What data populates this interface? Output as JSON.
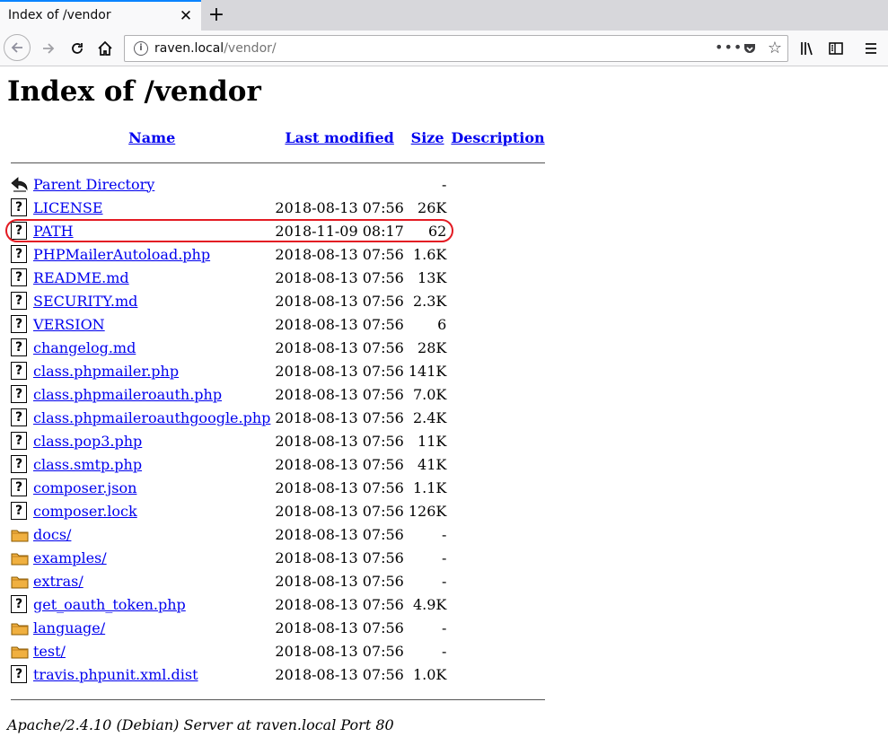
{
  "browser": {
    "tab_title": "Index of /vendor",
    "tab_close": "✕",
    "new_tab": "+",
    "url_host": "raven.local",
    "url_path": "/vendor/",
    "url_more": "•••"
  },
  "page": {
    "title": "Index of /vendor",
    "columns": {
      "name": "Name",
      "last_modified": "Last modified",
      "size": "Size",
      "description": "Description"
    },
    "parent": {
      "name": "Parent Directory",
      "size": "-"
    },
    "rows": [
      {
        "name": "LICENSE",
        "date": "2018-08-13 07:56",
        "size": "26K",
        "type": "file"
      },
      {
        "name": "PATH",
        "date": "2018-11-09 08:17",
        "size": "62",
        "type": "file"
      },
      {
        "name": "PHPMailerAutoload.php",
        "date": "2018-08-13 07:56",
        "size": "1.6K",
        "type": "file"
      },
      {
        "name": "README.md",
        "date": "2018-08-13 07:56",
        "size": "13K",
        "type": "file"
      },
      {
        "name": "SECURITY.md",
        "date": "2018-08-13 07:56",
        "size": "2.3K",
        "type": "file"
      },
      {
        "name": "VERSION",
        "date": "2018-08-13 07:56",
        "size": "6",
        "type": "file"
      },
      {
        "name": "changelog.md",
        "date": "2018-08-13 07:56",
        "size": "28K",
        "type": "file"
      },
      {
        "name": "class.phpmailer.php",
        "date": "2018-08-13 07:56",
        "size": "141K",
        "type": "file"
      },
      {
        "name": "class.phpmaileroauth.php",
        "date": "2018-08-13 07:56",
        "size": "7.0K",
        "type": "file"
      },
      {
        "name": "class.phpmaileroauthgoogle.php",
        "date": "2018-08-13 07:56",
        "size": "2.4K",
        "type": "file"
      },
      {
        "name": "class.pop3.php",
        "date": "2018-08-13 07:56",
        "size": "11K",
        "type": "file"
      },
      {
        "name": "class.smtp.php",
        "date": "2018-08-13 07:56",
        "size": "41K",
        "type": "file"
      },
      {
        "name": "composer.json",
        "date": "2018-08-13 07:56",
        "size": "1.1K",
        "type": "file"
      },
      {
        "name": "composer.lock",
        "date": "2018-08-13 07:56",
        "size": "126K",
        "type": "file"
      },
      {
        "name": "docs/",
        "date": "2018-08-13 07:56",
        "size": "-",
        "type": "folder"
      },
      {
        "name": "examples/",
        "date": "2018-08-13 07:56",
        "size": "-",
        "type": "folder"
      },
      {
        "name": "extras/",
        "date": "2018-08-13 07:56",
        "size": "-",
        "type": "folder"
      },
      {
        "name": "get_oauth_token.php",
        "date": "2018-08-13 07:56",
        "size": "4.9K",
        "type": "file"
      },
      {
        "name": "language/",
        "date": "2018-08-13 07:56",
        "size": "-",
        "type": "folder"
      },
      {
        "name": "test/",
        "date": "2018-08-13 07:56",
        "size": "-",
        "type": "folder"
      },
      {
        "name": "travis.phpunit.xml.dist",
        "date": "2018-08-13 07:56",
        "size": "1.0K",
        "type": "file"
      }
    ],
    "highlighted_row": "PATH",
    "highlight_color": "#e31b23",
    "link_color": "#0000ee",
    "folder_color": "#f0b040",
    "footer": "Apache/2.4.10 (Debian) Server at raven.local Port 80"
  }
}
